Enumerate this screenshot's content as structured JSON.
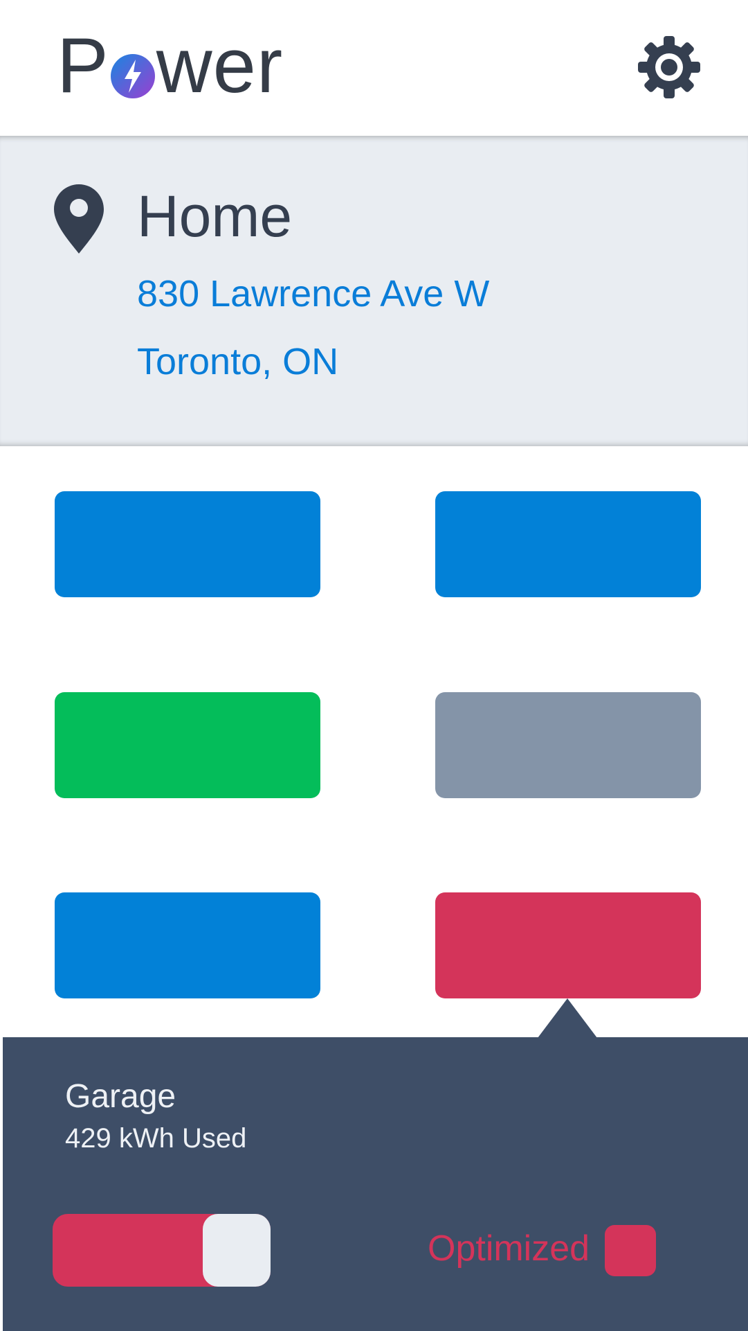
{
  "header": {
    "logo_prefix": "P",
    "logo_suffix": "wer",
    "logo_bolt_icon": "lightning-bolt-icon",
    "settings_icon": "gear-icon"
  },
  "location": {
    "icon": "map-pin-icon",
    "name": "Home",
    "address_line1": "830 Lawrence Ave W",
    "address_line2": "Toronto, ON"
  },
  "tiles": [
    {
      "color": "#0281d7"
    },
    {
      "color": "#0281d7"
    },
    {
      "color": "#04bd5a"
    },
    {
      "color": "#8494a8"
    },
    {
      "color": "#0281d7"
    },
    {
      "color": "#d4345a",
      "selected": true
    }
  ],
  "detail_panel": {
    "title": "Garage",
    "usage": "429 kWh Used",
    "toggle_on": true,
    "optimized_label": "Optimized",
    "optimized_checked": true
  },
  "colors": {
    "blue": "#0281d7",
    "green": "#04bd5a",
    "gray": "#8494a8",
    "red": "#d4345a",
    "panel": "#3e4e67",
    "text_dark": "#353f50"
  }
}
